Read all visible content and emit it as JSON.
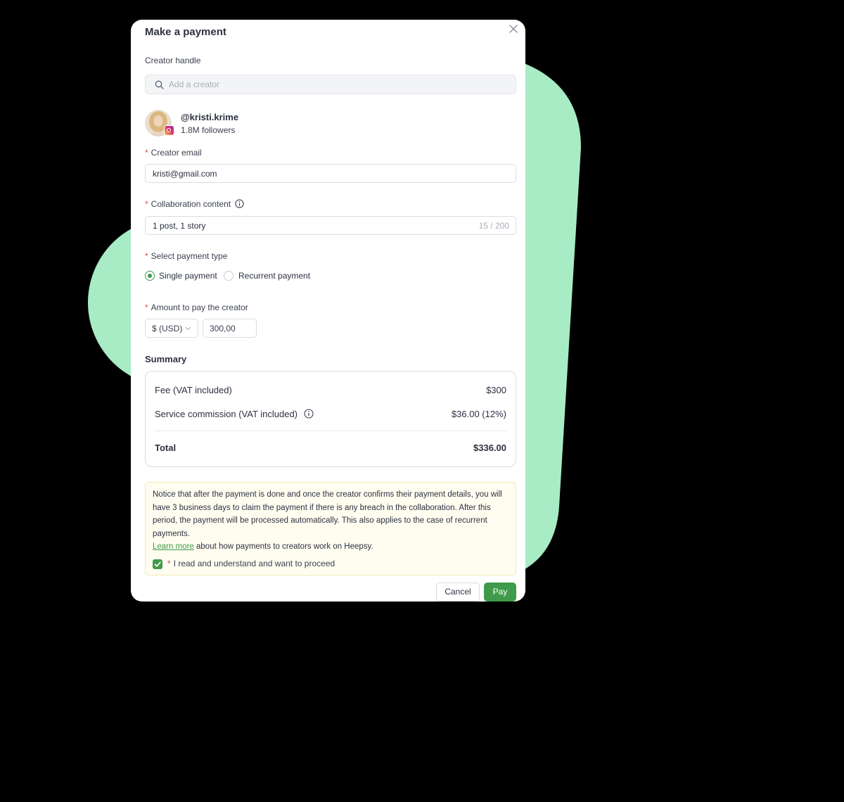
{
  "colors": {
    "backdrop": "#000000",
    "blob": "#a8ecc6",
    "accent": "#3f9b49",
    "required": "#e5484d",
    "notice_bg": "#fffdf0"
  },
  "modal": {
    "title": "Make a payment",
    "close_icon": "close-icon"
  },
  "creator_handle": {
    "label": "Creator handle",
    "placeholder": "Add a creator",
    "icon": "search-icon"
  },
  "creator": {
    "handle": "@kristi.krime",
    "followers": "1.8M followers",
    "platform_icon": "instagram-icon"
  },
  "creator_email": {
    "required_mark": "*",
    "label": "Creator email",
    "value": "kristi@gmail.com"
  },
  "collaboration": {
    "required_mark": "*",
    "label": "Collaboration content",
    "value": "1 post, 1 story",
    "counter": "15 / 200",
    "icon": "info-icon"
  },
  "payment_type": {
    "required_mark": "*",
    "label": "Select payment type",
    "options": [
      {
        "label": "Single payment",
        "selected": true
      },
      {
        "label": "Recurrent payment",
        "selected": false
      }
    ]
  },
  "amount": {
    "required_mark": "*",
    "label": "Amount to pay the creator",
    "currency": "$ (USD)",
    "value": "300,00"
  },
  "summary": {
    "title": "Summary",
    "fee_label": "Fee (VAT included)",
    "fee_value": "$300",
    "commission_label": "Service commission (VAT included)",
    "commission_value": "$36.00 (12%)",
    "total_label": "Total",
    "total_value": "$336.00"
  },
  "notice": {
    "text": "Notice that after the payment is done and once the creator confirms their payment details, you will have 3 business days to claim the payment if there is any breach in the collaboration. After this period, the payment will be processed automatically. This also applies to the case of recurrent payments.",
    "link_text": "Learn more",
    "link_suffix": " about how payments to creators work on Heepsy.",
    "checkbox_required_mark": "*",
    "checkbox_label": "I read and understand and want to proceed",
    "checked": true
  },
  "actions": {
    "cancel_label": "Cancel",
    "pay_label": "Pay"
  }
}
